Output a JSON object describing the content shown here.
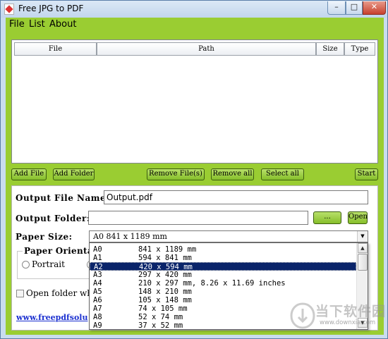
{
  "window": {
    "title": "Free JPG to PDF",
    "minimize_glyph": "–",
    "maximize_glyph": "□",
    "close_glyph": "✕"
  },
  "menu": {
    "items": [
      "File",
      "List",
      "About"
    ]
  },
  "file_list": {
    "columns": [
      "File",
      "Path",
      "Size",
      "Type"
    ],
    "rows": []
  },
  "buttons": {
    "add_file": "Add File",
    "add_folder": "Add Folder",
    "remove_files": "Remove File(s)",
    "remove_all": "Remove all",
    "select_all": "Select all",
    "start": "Start",
    "browse": "...",
    "open": "Open"
  },
  "options": {
    "output_file_name_label": "Output File Name:",
    "output_file_name_value": "Output.pdf",
    "output_folder_label": "Output Folder:",
    "output_folder_value": "",
    "paper_size_label": "Paper Size:",
    "paper_size_selected": "A0 841 x 1189 mm",
    "paper_orientation_label": "Paper Orientat",
    "portrait_label": "Portrait",
    "open_folder_label": "Open folder whe",
    "website_link": "www.freepdfsolu"
  },
  "paper_size_options": [
    {
      "name": "A0",
      "size": "841 x 1189 mm"
    },
    {
      "name": "A1",
      "size": "594 x 841 mm"
    },
    {
      "name": "A2",
      "size": "420 x 594 mm",
      "selected": true
    },
    {
      "name": "A3",
      "size": "297 x 420 mm"
    },
    {
      "name": "A4",
      "size": "210 x 297 mm, 8.26 x 11.69 inches"
    },
    {
      "name": "A5",
      "size": "148 x 210 mm"
    },
    {
      "name": "A6",
      "size": "105 x 148 mm"
    },
    {
      "name": "A7",
      "size": "74 x 105 mm"
    },
    {
      "name": "A8",
      "size": "52 x 74 mm"
    },
    {
      "name": "A9",
      "size": "37 x 52 mm"
    }
  ],
  "watermark": {
    "text": "当下软件园",
    "url": "www.downxia.com"
  },
  "colors": {
    "accent_green": "#9acd32",
    "selection_blue": "#0a246a",
    "link_blue": "#1a2fd0"
  }
}
